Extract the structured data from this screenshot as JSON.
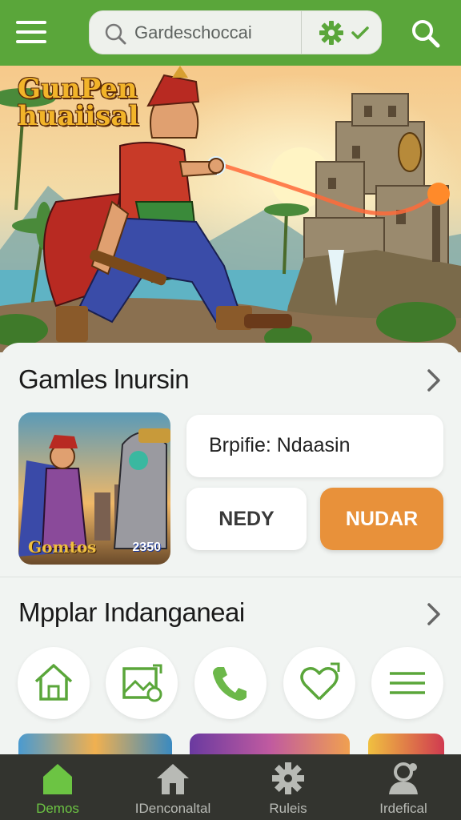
{
  "header": {
    "search_placeholder": "Gardeschoccai",
    "icons": [
      "menu-icon",
      "search-icon",
      "gear-icon",
      "check-icon",
      "search-icon"
    ]
  },
  "hero": {
    "title_logo": "GunPen huaiisal"
  },
  "section1": {
    "title": "Gamles lnursin",
    "thumbnail": {
      "label": "Gomtos",
      "number": "2350"
    },
    "info_card": "Brpifie: Ndaasin",
    "secondary_button": "NEDY",
    "primary_button": "NUDAR"
  },
  "section2": {
    "title": "Mpplar Indanganeai",
    "quick_actions": [
      "home-icon",
      "image-icon",
      "phone-icon",
      "heart-icon",
      "list-icon"
    ]
  },
  "bottom_nav": {
    "items": [
      {
        "label": "Demos",
        "icon": "home-icon",
        "active": true
      },
      {
        "label": "IDenconaltal",
        "icon": "house-icon",
        "active": false
      },
      {
        "label": "Ruleis",
        "icon": "gear-icon",
        "active": false
      },
      {
        "label": "Irdefical",
        "icon": "user-icon",
        "active": false
      }
    ]
  },
  "colors": {
    "accent_green": "#5aa63a",
    "nav_active": "#6cc443",
    "primary_button": "#e8913a",
    "nav_background": "#33342f"
  }
}
